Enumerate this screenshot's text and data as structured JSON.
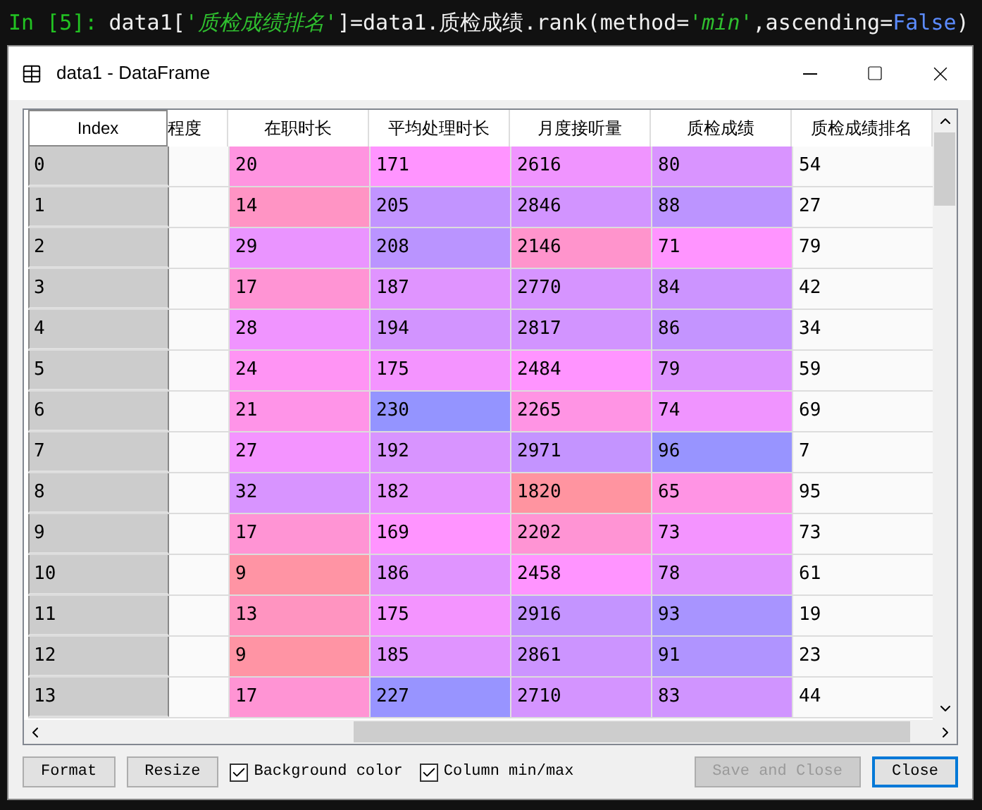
{
  "code_line": {
    "prompt": "In [5]:",
    "segments": [
      {
        "kind": "plain",
        "text": "data1["
      },
      {
        "kind": "string",
        "text": "'质检成绩排名'"
      },
      {
        "kind": "plain",
        "text": "]=data1.质检成绩.rank(method="
      },
      {
        "kind": "string",
        "text": "'min'"
      },
      {
        "kind": "plain",
        "text": ",ascending="
      },
      {
        "kind": "keyword",
        "text": "False"
      },
      {
        "kind": "plain",
        "text": ")"
      }
    ]
  },
  "window": {
    "title": "data1 - DataFrame"
  },
  "table": {
    "index_header": "Index",
    "columns": [
      "程度",
      "在职时长",
      "平均处理时长",
      "月度接听量",
      "质检成绩",
      "质检成绩排名"
    ],
    "rows": [
      {
        "index": "0",
        "cells": [
          {
            "text": ""
          },
          {
            "text": "20",
            "color": "#ff94e0"
          },
          {
            "text": "171",
            "color": "#ff94ff"
          },
          {
            "text": "2616",
            "color": "#f094ff"
          },
          {
            "text": "80",
            "color": "#d994ff"
          },
          {
            "text": "54"
          }
        ]
      },
      {
        "index": "1",
        "cells": [
          {
            "text": ""
          },
          {
            "text": "14",
            "color": "#ff94c4"
          },
          {
            "text": "205",
            "color": "#c294ff"
          },
          {
            "text": "2846",
            "color": "#d294ff"
          },
          {
            "text": "88",
            "color": "#bc94ff"
          },
          {
            "text": "27"
          }
        ]
      },
      {
        "index": "2",
        "cells": [
          {
            "text": ""
          },
          {
            "text": "29",
            "color": "#ea94ff"
          },
          {
            "text": "208",
            "color": "#ba94ff"
          },
          {
            "text": "2146",
            "color": "#ff94cc"
          },
          {
            "text": "71",
            "color": "#ff94ff"
          },
          {
            "text": "79"
          }
        ]
      },
      {
        "index": "3",
        "cells": [
          {
            "text": ""
          },
          {
            "text": "17",
            "color": "#ff94d4"
          },
          {
            "text": "187",
            "color": "#e094ff"
          },
          {
            "text": "2770",
            "color": "#d694ff"
          },
          {
            "text": "84",
            "color": "#cc94ff"
          },
          {
            "text": "42"
          }
        ]
      },
      {
        "index": "4",
        "cells": [
          {
            "text": ""
          },
          {
            "text": "28",
            "color": "#f094ff"
          },
          {
            "text": "194",
            "color": "#d294ff"
          },
          {
            "text": "2817",
            "color": "#d294ff"
          },
          {
            "text": "86",
            "color": "#c494ff"
          },
          {
            "text": "34"
          }
        ]
      },
      {
        "index": "5",
        "cells": [
          {
            "text": ""
          },
          {
            "text": "24",
            "color": "#ff94f4"
          },
          {
            "text": "175",
            "color": "#f494ff"
          },
          {
            "text": "2484",
            "color": "#ff94ff"
          },
          {
            "text": "79",
            "color": "#dc94ff"
          },
          {
            "text": "59"
          }
        ]
      },
      {
        "index": "6",
        "cells": [
          {
            "text": ""
          },
          {
            "text": "21",
            "color": "#ff94e8"
          },
          {
            "text": "230",
            "color": "#9494ff"
          },
          {
            "text": "2265",
            "color": "#ff94e4"
          },
          {
            "text": "74",
            "color": "#f094ff"
          },
          {
            "text": "69"
          }
        ]
      },
      {
        "index": "7",
        "cells": [
          {
            "text": ""
          },
          {
            "text": "27",
            "color": "#f494ff"
          },
          {
            "text": "192",
            "color": "#d894ff"
          },
          {
            "text": "2971",
            "color": "#c494ff"
          },
          {
            "text": "96",
            "color": "#9894ff"
          },
          {
            "text": "7"
          }
        ]
      },
      {
        "index": "8",
        "cells": [
          {
            "text": ""
          },
          {
            "text": "32",
            "color": "#d894ff"
          },
          {
            "text": "182",
            "color": "#e694ff"
          },
          {
            "text": "1820",
            "color": "#ff94a0"
          },
          {
            "text": "65",
            "color": "#ff94e4"
          },
          {
            "text": "95"
          }
        ]
      },
      {
        "index": "9",
        "cells": [
          {
            "text": ""
          },
          {
            "text": "17",
            "color": "#ff94d4"
          },
          {
            "text": "169",
            "color": "#ff94ff"
          },
          {
            "text": "2202",
            "color": "#ff94d4"
          },
          {
            "text": "73",
            "color": "#f494ff"
          },
          {
            "text": "73"
          }
        ]
      },
      {
        "index": "10",
        "cells": [
          {
            "text": ""
          },
          {
            "text": "9",
            "color": "#ff94a4"
          },
          {
            "text": "186",
            "color": "#e094ff"
          },
          {
            "text": "2458",
            "color": "#ff94ff"
          },
          {
            "text": "78",
            "color": "#e094ff"
          },
          {
            "text": "61"
          }
        ]
      },
      {
        "index": "11",
        "cells": [
          {
            "text": ""
          },
          {
            "text": "13",
            "color": "#ff94c0"
          },
          {
            "text": "175",
            "color": "#f494ff"
          },
          {
            "text": "2916",
            "color": "#c494ff"
          },
          {
            "text": "93",
            "color": "#a894ff"
          },
          {
            "text": "19"
          }
        ]
      },
      {
        "index": "12",
        "cells": [
          {
            "text": ""
          },
          {
            "text": "9",
            "color": "#ff94a4"
          },
          {
            "text": "185",
            "color": "#e094ff"
          },
          {
            "text": "2861",
            "color": "#cc94ff"
          },
          {
            "text": "91",
            "color": "#b094ff"
          },
          {
            "text": "23"
          }
        ]
      },
      {
        "index": "13",
        "cells": [
          {
            "text": ""
          },
          {
            "text": "17",
            "color": "#ff94d4"
          },
          {
            "text": "227",
            "color": "#9894ff"
          },
          {
            "text": "2710",
            "color": "#d494ff"
          },
          {
            "text": "83",
            "color": "#d094ff"
          },
          {
            "text": "44"
          }
        ]
      }
    ]
  },
  "buttons": [
    {
      "label": "Format",
      "disabled": false
    },
    {
      "label": "Resize",
      "disabled": false
    }
  ],
  "checkboxes": [
    {
      "label": "Background color",
      "checked": true
    },
    {
      "label": "Column min/max",
      "checked": true
    }
  ],
  "actions": [
    {
      "label": "Save and Close",
      "disabled": true
    },
    {
      "label": "Close",
      "disabled": false
    }
  ]
}
